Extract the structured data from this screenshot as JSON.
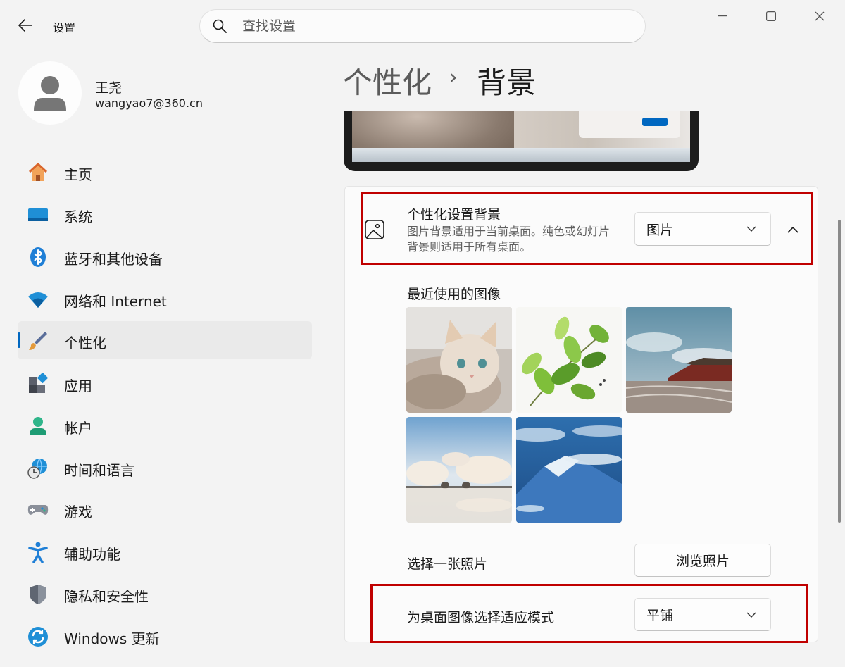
{
  "titlebar": {
    "app_title": "设置",
    "search_placeholder": "查找设置"
  },
  "user": {
    "name": "王尧",
    "email": "wangyao7@360.cn"
  },
  "nav": {
    "items": [
      {
        "label": "主页",
        "icon": "home-icon"
      },
      {
        "label": "系统",
        "icon": "system-icon"
      },
      {
        "label": "蓝牙和其他设备",
        "icon": "bluetooth-icon"
      },
      {
        "label": "网络和 Internet",
        "icon": "wifi-icon"
      },
      {
        "label": "个性化",
        "icon": "brush-icon",
        "active": true
      },
      {
        "label": "应用",
        "icon": "apps-icon"
      },
      {
        "label": "帐户",
        "icon": "account-icon"
      },
      {
        "label": "时间和语言",
        "icon": "time-language-icon"
      },
      {
        "label": "游戏",
        "icon": "gamepad-icon"
      },
      {
        "label": "辅助功能",
        "icon": "accessibility-icon"
      },
      {
        "label": "隐私和安全性",
        "icon": "shield-icon"
      },
      {
        "label": "Windows 更新",
        "icon": "update-icon"
      }
    ]
  },
  "header": {
    "parent": "个性化",
    "separator": "›",
    "current": "背景"
  },
  "background": {
    "title": "个性化设置背景",
    "description": "图片背景适用于当前桌面。纯色或幻灯片背景则适用于所有桌面。",
    "type_value": "图片",
    "recent_title": "最近使用的图像",
    "recent_images": [
      "cat",
      "green-leaves",
      "forbidden-city",
      "beach-pier",
      "blue-mountains"
    ],
    "choose_photo_label": "选择一张照片",
    "browse_button": "浏览照片",
    "fit_label": "为桌面图像选择适应模式",
    "fit_value": "平铺"
  },
  "colors": {
    "accent": "#0067c0",
    "highlight_box": "#c00000"
  }
}
